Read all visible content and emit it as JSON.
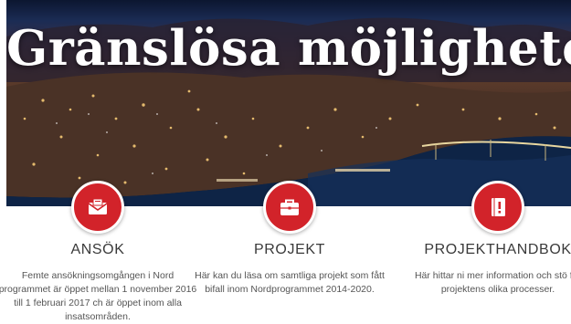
{
  "hero": {
    "title": "Gränslösa möjligheter"
  },
  "features": [
    {
      "icon": "envelope-icon",
      "title": "ANSÖK",
      "text": "Femte ansökningsomgången i Nord programmet är öppet mellan 1 november 2016 till 1 februari 2017 ch är öppet inom alla insatsområden."
    },
    {
      "icon": "briefcase-icon",
      "title": "PROJEKT",
      "text": "Här kan du läsa om samtliga projekt som fått bifall inom Nordprogrammet 2014-2020."
    },
    {
      "icon": "handbook-icon",
      "title": "PROJEKTHANDBOK",
      "text": "Här hittar ni mer information och stö för projektens olika processer."
    }
  ],
  "colors": {
    "accent": "#d2232a",
    "heading": "#3a3a3a",
    "body_text": "#555555"
  }
}
